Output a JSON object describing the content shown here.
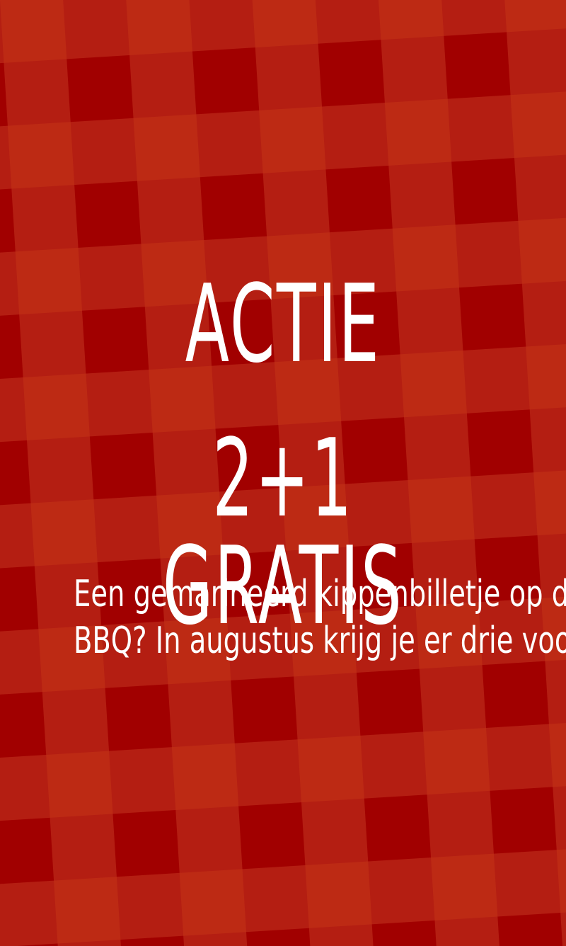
{
  "promo": {
    "headline_line1": "ACTIE",
    "headline_line2": "2+1 GRATIS",
    "body_line1": "Een gemarineerd kippenbilletje op de",
    "body_line2": "BBQ? In augustus krijg je er drie voor"
  },
  "colors": {
    "base": "#b41e12",
    "light": "#bd2a14",
    "dark": "#a10000",
    "text": "#ffffff"
  }
}
